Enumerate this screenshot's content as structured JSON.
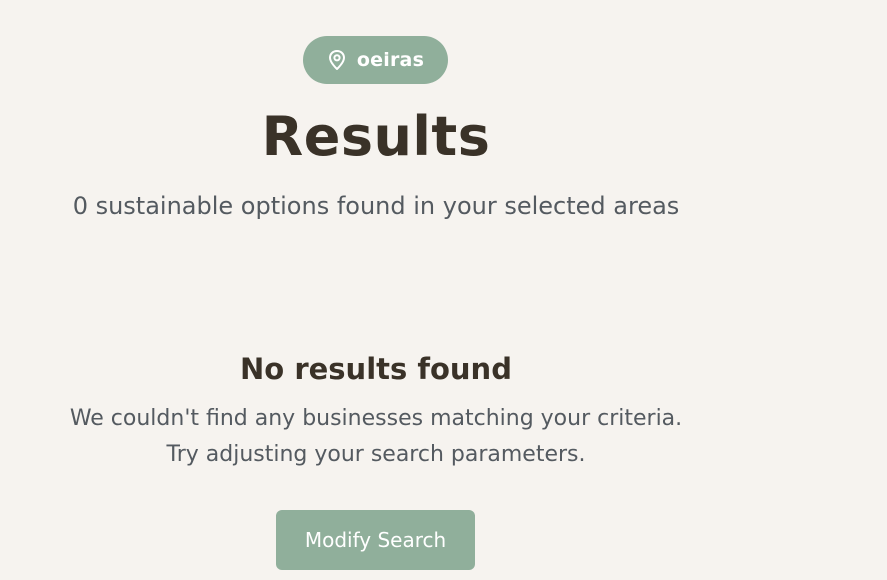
{
  "location_chip": {
    "label": "oeiras",
    "icon": "map-pin-icon"
  },
  "header": {
    "title": "Results",
    "subtitle": "0 sustainable options found in your selected areas"
  },
  "empty_state": {
    "heading": "No results found",
    "line1": "We couldn't find any businesses matching your criteria.",
    "line2": "Try adjusting your search parameters."
  },
  "actions": {
    "modify_label": "Modify Search"
  },
  "colors": {
    "background": "#f6f3ef",
    "accent": "#90af9b",
    "heading": "#3a3228",
    "body_text": "#545a60"
  }
}
